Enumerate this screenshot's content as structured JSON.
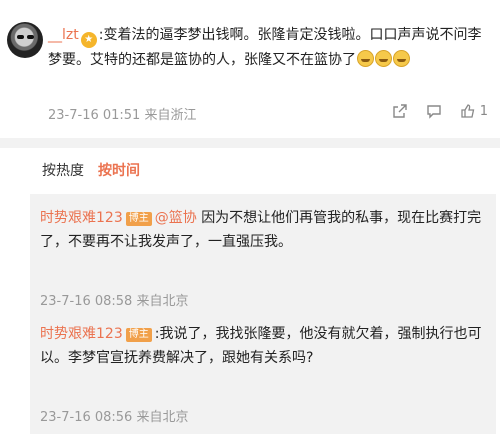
{
  "comment": {
    "username": "__lzt",
    "text": ":变着法的逼李梦出钱啊。张隆肯定没钱啦。口口声声说不问李梦要。艾特的还都是篮协的人，张隆又不在篮协了",
    "timestamp": "23-7-16 01:51",
    "location": "来自浙江",
    "like_count": "1"
  },
  "sort_tabs": {
    "hot": "按热度",
    "time": "按时间"
  },
  "replies": [
    {
      "username": "时势艰难123",
      "badge": "博主",
      "mention": "@篮协",
      "text": "因为不想让他们再管我的私事，现在比赛打完了，不要再不让我发声了，一直强压我。",
      "timestamp": "23-7-16 08:58",
      "location": "来自北京"
    },
    {
      "username": "时势艰难123",
      "badge": "博主",
      "text": ":我说了，我找张隆要，他没有就欠着，强制执行也可以。李梦官宣抚养费解决了，跟她有关系吗?",
      "timestamp": "23-7-16 08:56",
      "location": "来自北京"
    }
  ]
}
